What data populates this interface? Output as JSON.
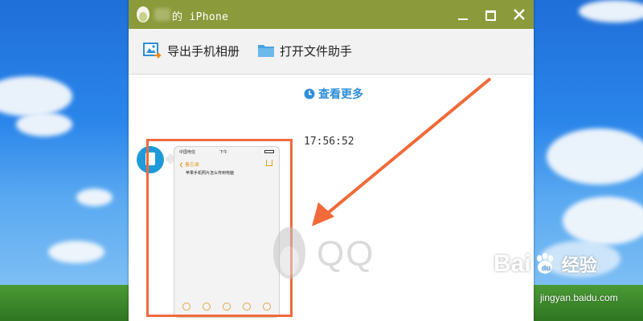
{
  "window": {
    "title": "iPhone",
    "title_prefix": "的"
  },
  "toolbar": {
    "export_label": "导出手机相册",
    "filehelper_label": "打开文件助手"
  },
  "chat": {
    "more_label": "查看更多",
    "timestamp": "17:56:52",
    "phone_status_carrier": "中国电信",
    "phone_status_time": "下午",
    "phone_back_label": "备忘录",
    "phone_note_text": "苹果手机照片怎么传到电脑"
  },
  "watermark": {
    "qq_text": "QQ"
  },
  "baidu": {
    "logo_left": "Bai",
    "logo_right": "经验",
    "url": "jingyan.baidu.com"
  },
  "colors": {
    "titlebar": "#8b9a3a",
    "accent": "#2f8fd8",
    "highlight": "#f06a3a"
  }
}
